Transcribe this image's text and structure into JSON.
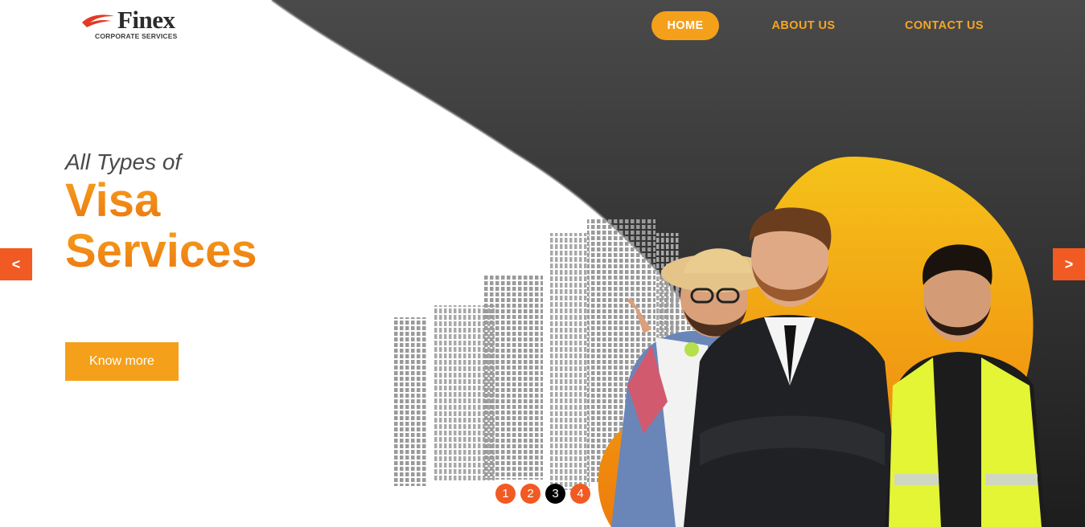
{
  "logo": {
    "name": "Finex",
    "tagline": "CORPORATE SERVICES",
    "mark_icon": "swoosh-icon",
    "mark_color": "#e23b24"
  },
  "nav": {
    "items": [
      {
        "label": "HOME",
        "active": true
      },
      {
        "label": "ABOUT US",
        "active": false
      },
      {
        "label": "CONTACT US",
        "active": false
      }
    ]
  },
  "hero": {
    "kicker": "All Types of",
    "title_line1": "Visa",
    "title_line2": "Services",
    "cta_label": "Know more",
    "image_description_icon": "team-photo",
    "prev_label": "<",
    "next_label": ">"
  },
  "slider": {
    "dots": [
      "1",
      "2",
      "3",
      "4"
    ],
    "active_index": 3
  },
  "colors": {
    "accent": "#f5a01a",
    "arrow": "#f15a22",
    "dark_panel": "#2e2e2e",
    "title_gradient_start": "#f7a21b",
    "title_gradient_end": "#ea7410"
  }
}
